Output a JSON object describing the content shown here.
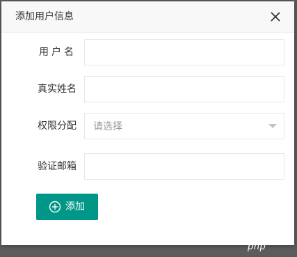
{
  "dialog": {
    "title": "添加用户信息",
    "close_icon": "close-icon"
  },
  "form": {
    "username": {
      "label": "用户名",
      "value": ""
    },
    "realname": {
      "label": "真实姓名",
      "value": ""
    },
    "permission": {
      "label": "权限分配",
      "placeholder": "请选择",
      "arrow_icon": "caret-down-icon"
    },
    "email": {
      "label": "验证邮箱",
      "value": ""
    }
  },
  "actions": {
    "add_label": "添加",
    "add_icon": "plus-circle-icon"
  },
  "watermark": "php",
  "colors": {
    "accent": "#009688",
    "header_bg": "#f8f8f8",
    "border": "#e6e6e6",
    "backdrop": "#5c5c5c"
  }
}
